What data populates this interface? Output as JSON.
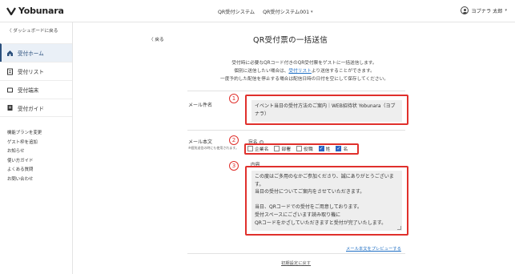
{
  "header": {
    "brand": "Yobunara",
    "nav": [
      "QR受付システム",
      "QR受付システム001"
    ],
    "user": "ヨブナラ 太郎"
  },
  "sidebar": {
    "back": "〈 ダッシュボードに戻る",
    "items": [
      {
        "label": "受付ホーム",
        "icon": "home-icon"
      },
      {
        "label": "受付リスト",
        "icon": "list-icon"
      },
      {
        "label": "受付端末",
        "icon": "tablet-icon"
      },
      {
        "label": "受付ガイド",
        "icon": "book-icon"
      }
    ],
    "links": [
      "機能プランを変更",
      "ゲスト枠を追加",
      "お知らせ",
      "使い方ガイド",
      "よくある質問",
      "お問い合わせ"
    ]
  },
  "main": {
    "back": "〈 戻る",
    "title": "QR受付票の一括送信",
    "desc_line1": "受付時に必要なQRコード付きのQR受付票をゲストに一括送信します。",
    "desc_line2_pre": "個別に送信したい場合は、",
    "desc_line2_link": "受付リスト",
    "desc_line2_post": "より送信することができます。",
    "desc_line3": "一度予約した配信を停止する場合は配信日時の日付を空にして保存してください。",
    "subject_label": "メール件名",
    "subject_value": "イベント当日の受付方法のご案内｜WEB招待状 Yobunara（ヨブナラ）",
    "body_label": "メール本文",
    "body_note": "※個別送信の時にも使用されます。",
    "atena_label": "宛名",
    "atena_help": "?",
    "checkboxes": [
      {
        "label": "企業名",
        "checked": false
      },
      {
        "label": "部署",
        "checked": false
      },
      {
        "label": "役職",
        "checked": false
      },
      {
        "label": "姓",
        "checked": true
      },
      {
        "label": "名",
        "checked": true
      }
    ],
    "content_label": "内容",
    "content_value": "この度はご多用のなかご参加くださり、誠にありがとうございます。\n当日の受付についてご案内をさせていただきます。\n\n当日、QRコードでの受付をご用意しております。\n受付スペースにございます読み取り機に\nQRコードをかざしていただきますと受付が完了いたします。",
    "preview_link": "メール本文をプレビューする",
    "reset_link": "初期設定に戻す",
    "markers": [
      "1",
      "2",
      "3"
    ]
  },
  "colors": {
    "accent": "#2a4f7c",
    "link": "#1f6fc4",
    "highlight": "#e0302c",
    "checkbox": "#2a64c4"
  }
}
